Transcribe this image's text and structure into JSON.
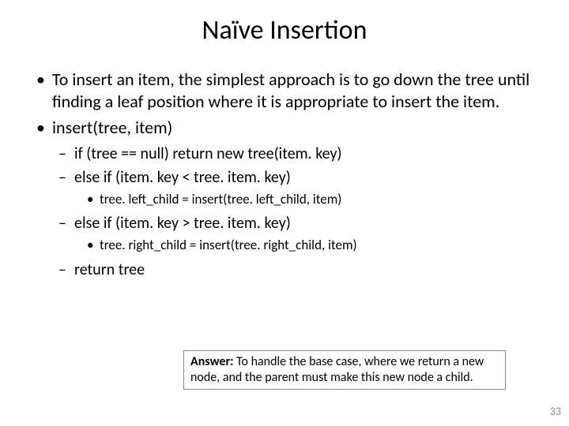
{
  "title": "Naïve Insertion",
  "bullets": {
    "b1": "To insert an item, the simplest approach is to go down the tree until finding a leaf position where it is appropriate to insert the item.",
    "b2": "insert(tree, item)",
    "s1": "if (tree == null) return new tree(item. key)",
    "s2": "else if (item. key  <  tree. item. key)",
    "s2a": "tree. left_child = insert(tree. left_child, item)",
    "s3": "else if (item. key  >  tree. item. key)",
    "s3a": "tree. right_child = insert(tree. right_child, item)",
    "s4": "return tree"
  },
  "answer": {
    "label": "Answer:",
    "text": " To handle the base case, where we return a new node, and the parent must make this new node a child."
  },
  "page": "33"
}
